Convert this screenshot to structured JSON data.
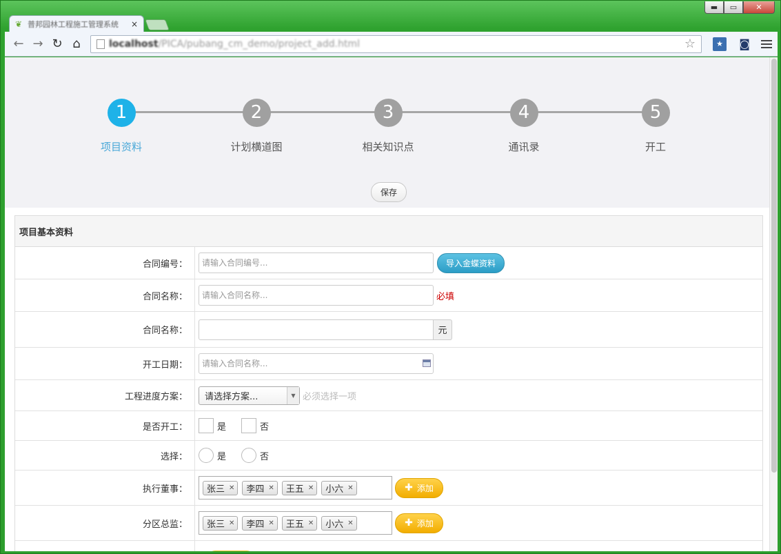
{
  "browser": {
    "tab_title": "普邦园林工程施工管理系统",
    "tab_close": "×",
    "url_host": "localhost",
    "url_path": "/PICA/pubang_cm_demo/project_add.html",
    "window_controls": {
      "minimize": "▬",
      "maximize": "▭",
      "close": "✕"
    }
  },
  "steps": [
    {
      "number": "1",
      "label": "项目资料",
      "active": true
    },
    {
      "number": "2",
      "label": "计划横道图",
      "active": false
    },
    {
      "number": "3",
      "label": "相关知识点",
      "active": false
    },
    {
      "number": "4",
      "label": "通讯录",
      "active": false
    },
    {
      "number": "5",
      "label": "开工",
      "active": false
    }
  ],
  "save_label": "保存",
  "panel": {
    "title": "项目基本资料",
    "rows": {
      "contract_no": {
        "label": "合同编号：",
        "placeholder": "请输入合同编号...",
        "button": "导入金蝶资料"
      },
      "contract_name": {
        "label": "合同名称：",
        "placeholder": "请输入合同名称...",
        "required": "必填"
      },
      "contract_amount": {
        "label": "合同名称：",
        "addon": "元"
      },
      "start_date": {
        "label": "开工日期：",
        "placeholder": "请输入合同名称..."
      },
      "schedule_plan": {
        "label": "工程进度方案：",
        "selected": "请选择方案...",
        "hint": "必须选择一项"
      },
      "started": {
        "label": "是否开工：",
        "options": [
          "是",
          "否"
        ]
      },
      "choice": {
        "label": "选择：",
        "options": [
          "是",
          "否"
        ]
      },
      "executive_director": {
        "label": "执行董事：",
        "tags": [
          "张三",
          "李四",
          "王五",
          "小六"
        ],
        "add_button": "添加"
      },
      "district_director": {
        "label": "分区总监：",
        "tags": [
          "张三",
          "李四",
          "王五",
          "小六"
        ],
        "add_button": "添加"
      }
    }
  },
  "colors": {
    "active_step": "#1eb2e8",
    "inactive_step": "#a0a0a0",
    "required": "#cc0000",
    "orange_button": "#f2ad00",
    "blue_button": "#2c9dc6"
  }
}
